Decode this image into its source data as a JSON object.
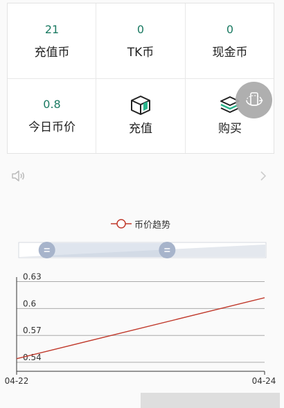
{
  "stats": {
    "recharge_coin": {
      "value": "21",
      "label": "充值币"
    },
    "tk_coin": {
      "value": "0",
      "label": "TK币"
    },
    "cash_coin": {
      "value": "0",
      "label": "现金币"
    },
    "today_price": {
      "value": "0.8",
      "label": "今日币价"
    },
    "recharge": {
      "label": "充值",
      "icon": "package-box-icon"
    },
    "buy": {
      "label": "购买",
      "icon": "layers-stack-icon"
    }
  },
  "notice": {
    "text": "",
    "icon": "speaker-icon"
  },
  "floating_button": {
    "icon": "rotate-phone-icon"
  },
  "colors": {
    "accent": "#1b7a62",
    "line": "#c0392b",
    "slider": "#9fb0cc"
  },
  "chart_data": {
    "type": "line",
    "legend": "币价趋势",
    "categories": [
      "04-22",
      "04-24"
    ],
    "x_tick_labels": [
      "04-22",
      "04-24"
    ],
    "y_tick_labels": [
      "0.54",
      "0.57",
      "0.6",
      "0.63"
    ],
    "ylim": [
      0.53,
      0.635
    ],
    "series": [
      {
        "name": "币价趋势",
        "x": [
          "04-22",
          "04-24"
        ],
        "values": [
          0.544,
          0.612
        ]
      }
    ],
    "legend_position": "top-center",
    "grid": true,
    "zoom_range": [
      0.1,
      0.62
    ]
  }
}
